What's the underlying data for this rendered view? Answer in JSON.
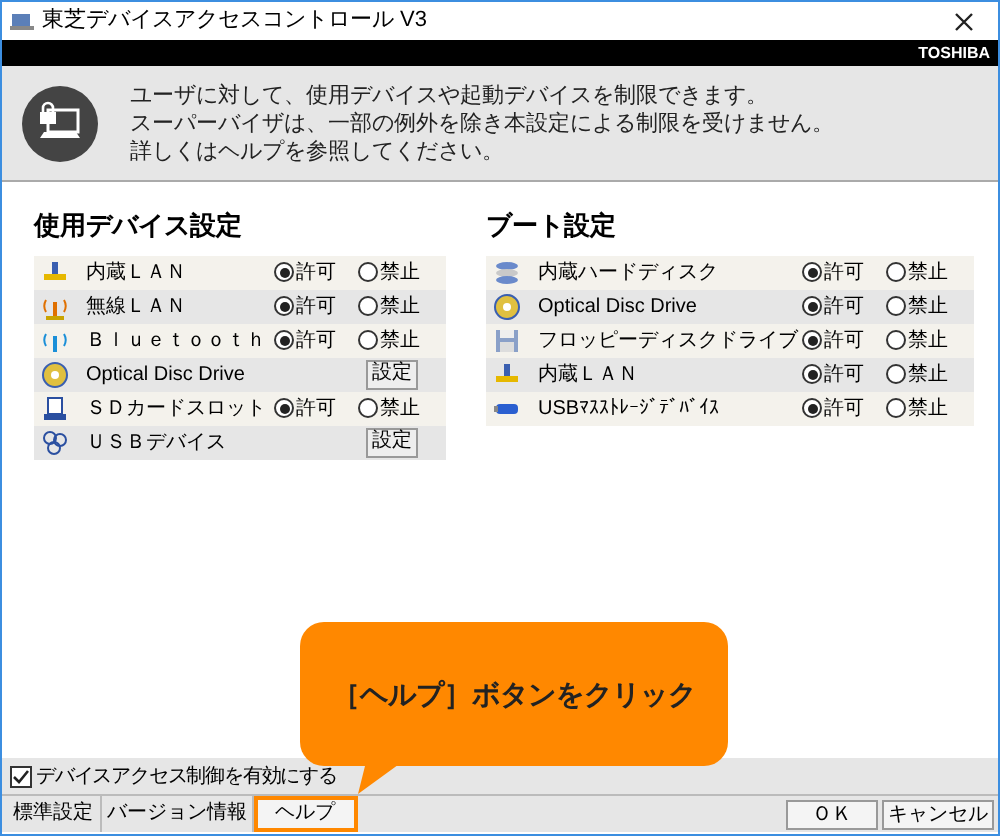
{
  "window": {
    "title": "東芝デバイスアクセスコントロール V3"
  },
  "brand": "TOSHIBA",
  "info": {
    "lines": [
      "ユーザに対して、使用デバイスや起動デバイスを制限できます。",
      "スーパーバイザは、一部の例外を除き本設定による制限を受けません。",
      "詳しくはヘルプを参照してください。"
    ]
  },
  "sections": [
    {
      "title": "使用デバイス設定",
      "rows": [
        {
          "label": "内蔵ＬＡＮ",
          "kind": "radio",
          "options": [
            {
              "label": "許可",
              "selected": true
            },
            {
              "label": "禁止",
              "selected": false
            }
          ]
        },
        {
          "label": "無線ＬＡＮ",
          "kind": "radio",
          "options": [
            {
              "label": "許可",
              "selected": true
            },
            {
              "label": "禁止",
              "selected": false
            }
          ]
        },
        {
          "label": "Ｂｌｕｅｔｏｏｔｈ",
          "kind": "radio",
          "options": [
            {
              "label": "許可",
              "selected": true
            },
            {
              "label": "禁止",
              "selected": false
            }
          ]
        },
        {
          "label": "Optical Disc Drive",
          "kind": "button",
          "button": "設定"
        },
        {
          "label": "ＳＤカードスロット",
          "kind": "radio",
          "options": [
            {
              "label": "許可",
              "selected": true
            },
            {
              "label": "禁止",
              "selected": false
            }
          ]
        },
        {
          "label": "ＵＳＢデバイス",
          "kind": "button",
          "button": "設定"
        }
      ]
    },
    {
      "title": "ブート設定",
      "rows": [
        {
          "label": "内蔵ハードディスク",
          "kind": "radio",
          "options": [
            {
              "label": "許可",
              "selected": true
            },
            {
              "label": "禁止",
              "selected": false
            }
          ]
        },
        {
          "label": "Optical Disc Drive",
          "kind": "radio",
          "options": [
            {
              "label": "許可",
              "selected": true
            },
            {
              "label": "禁止",
              "selected": false
            }
          ]
        },
        {
          "label": "フロッピーディスクドライブ",
          "kind": "radio",
          "options": [
            {
              "label": "許可",
              "selected": true
            },
            {
              "label": "禁止",
              "selected": false
            }
          ]
        },
        {
          "label": "内蔵ＬＡＮ",
          "kind": "radio",
          "options": [
            {
              "label": "許可",
              "selected": true
            },
            {
              "label": "禁止",
              "selected": false
            }
          ]
        },
        {
          "label": "USBﾏｽｽﾄﾚｰｼﾞﾃﾞﾊﾞｲｽ",
          "kind": "radio",
          "options": [
            {
              "label": "許可",
              "selected": true
            },
            {
              "label": "禁止",
              "selected": false
            }
          ]
        }
      ]
    }
  ],
  "callout": {
    "text": "［ヘルプ］ボタンをクリック"
  },
  "enable": {
    "label": "デバイスアクセス制御を有効にする",
    "checked": true
  },
  "buttons_left": [
    {
      "label": "標準設定",
      "highlighted": false
    },
    {
      "label": "バージョン情報",
      "highlighted": false
    },
    {
      "label": "ヘルプ",
      "highlighted": true
    }
  ],
  "buttons_right": [
    {
      "label": "ＯＫ"
    },
    {
      "label": "キャンセル"
    }
  ]
}
